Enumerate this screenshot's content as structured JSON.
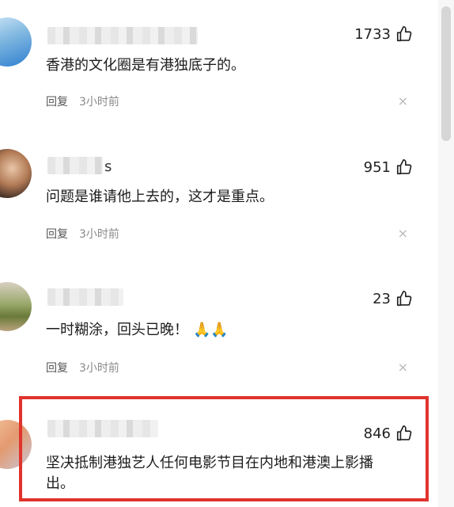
{
  "colors": {
    "highlight": "#e0332c",
    "meta_text": "#8a8a8a",
    "scroll_thumb": "#d6d6d6"
  },
  "comments": [
    {
      "likes": "1733",
      "text": "香港的文化圈是有港独底子的。",
      "reply_label": "回复",
      "time": "3小时前",
      "close": "×"
    },
    {
      "name_partial": "s",
      "likes": "951",
      "text": "问题是谁请他上去的，这才是重点。",
      "reply_label": "回复",
      "time": "3小时前",
      "close": "×"
    },
    {
      "likes": "23",
      "text": "一时糊涂，回头已晚！",
      "emoji": "🙏🙏",
      "reply_label": "回复",
      "time": "3小时前",
      "close": "×"
    },
    {
      "likes": "846",
      "text_line1": "坚决抵制港独艺人任何电影节目在内地和港澳上影播",
      "text_line2": "出。"
    }
  ],
  "icons": {
    "like": "thumbs-up-icon",
    "close": "close-icon"
  }
}
